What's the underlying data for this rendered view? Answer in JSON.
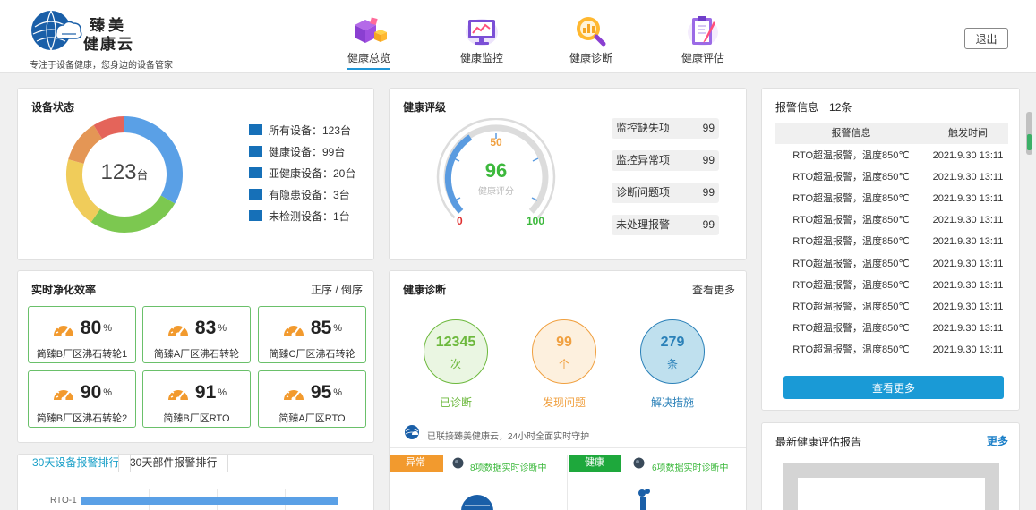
{
  "header": {
    "brand_line1": "臻美",
    "brand_line2": "健康云",
    "slogan": "专注于设备健康，您身边的设备管家",
    "nav": [
      {
        "label": "健康总览",
        "active": true
      },
      {
        "label": "健康监控",
        "active": false
      },
      {
        "label": "健康诊断",
        "active": false
      },
      {
        "label": "健康评估",
        "active": false
      }
    ],
    "logout_label": "退出"
  },
  "device_status": {
    "title": "设备状态",
    "total_number": "123",
    "total_unit": "台",
    "legend": [
      "所有设备：123台",
      "健康设备：99台",
      "亚健康设备：20台",
      "有隐患设备：3台",
      "未检测设备：1台"
    ],
    "ring_colors": [
      "#5aa0e6",
      "#7cc850",
      "#f0cc5a",
      "#e49655",
      "#e4645a"
    ],
    "legend_color": "#1670b8"
  },
  "health_grade": {
    "title": "健康评级",
    "score": "96",
    "score_label": "健康评分",
    "gauge_min": "0",
    "gauge_mid": "50",
    "gauge_max": "100",
    "items": [
      {
        "label": "监控缺失项",
        "value": "99"
      },
      {
        "label": "监控异常项",
        "value": "99"
      },
      {
        "label": "诊断问题项",
        "value": "99"
      },
      {
        "label": "未处理报警",
        "value": "99"
      }
    ]
  },
  "efficiency": {
    "title": "实时净化效率",
    "sort_label": "正序 / 倒序",
    "items": [
      {
        "value": "80",
        "unit": "%",
        "name": "简臻B厂区沸石转轮1"
      },
      {
        "value": "83",
        "unit": "%",
        "name": "简臻A厂区沸石转轮"
      },
      {
        "value": "85",
        "unit": "%",
        "name": "简臻C厂区沸石转轮"
      },
      {
        "value": "90",
        "unit": "%",
        "name": "简臻B厂区沸石转轮2"
      },
      {
        "value": "91",
        "unit": "%",
        "name": "简臻B厂区RTO"
      },
      {
        "value": "95",
        "unit": "%",
        "name": "简臻A厂区RTO"
      }
    ]
  },
  "ranking": {
    "tabs": [
      "30天设备报警排行",
      "30天部件报警排行"
    ],
    "first_label": "RTO-1"
  },
  "diagnosis": {
    "title": "健康诊断",
    "more_label": "查看更多",
    "circles": [
      {
        "value": "12345",
        "unit": "次",
        "caption": "已诊断",
        "color": "#6cb83c",
        "bg": "#eaf6e2"
      },
      {
        "value": "99",
        "unit": "个",
        "caption": "发现问题",
        "color": "#f0a040",
        "bg": "#fdf0de"
      },
      {
        "value": "279",
        "unit": "条",
        "caption": "解决措施",
        "color": "#2a80b8",
        "bg": "#bfe0ee"
      }
    ],
    "connect_text": "已联接臻美健康云，24小时全面实时守护",
    "status_abnormal": "异常",
    "status_abnormal_text": "8项数据实时诊断中",
    "status_healthy": "健康",
    "status_healthy_text": "6项数据实时诊断中"
  },
  "alarms": {
    "title": "报警信息",
    "count": "12条",
    "col1": "报警信息",
    "col2": "触发时间",
    "rows": [
      {
        "info": "RTO超温报警，温度850℃",
        "time": "2021.9.30 13:11"
      },
      {
        "info": "RTO超温报警，温度850℃",
        "time": "2021.9.30 13:11"
      },
      {
        "info": "RTO超温报警，温度850℃",
        "time": "2021.9.30 13:11"
      },
      {
        "info": "RTO超温报警，温度850℃",
        "time": "2021.9.30 13:11"
      },
      {
        "info": "RTO超温报警，温度850℃",
        "time": "2021.9.30 13:11"
      },
      {
        "info": "RTO超温报警，温度850℃",
        "time": "2021.9.30 13:11"
      },
      {
        "info": "RTO超温报警，温度850℃",
        "time": "2021.9.30 13:11"
      },
      {
        "info": "RTO超温报警，温度850℃",
        "time": "2021.9.30 13:11"
      },
      {
        "info": "RTO超温报警，温度850℃",
        "time": "2021.9.30 13:11"
      },
      {
        "info": "RTO超温报警，温度850℃",
        "time": "2021.9.30 13:11"
      }
    ],
    "more_button": "查看更多"
  },
  "report": {
    "title": "最新健康评估报告",
    "more_label": "更多"
  }
}
